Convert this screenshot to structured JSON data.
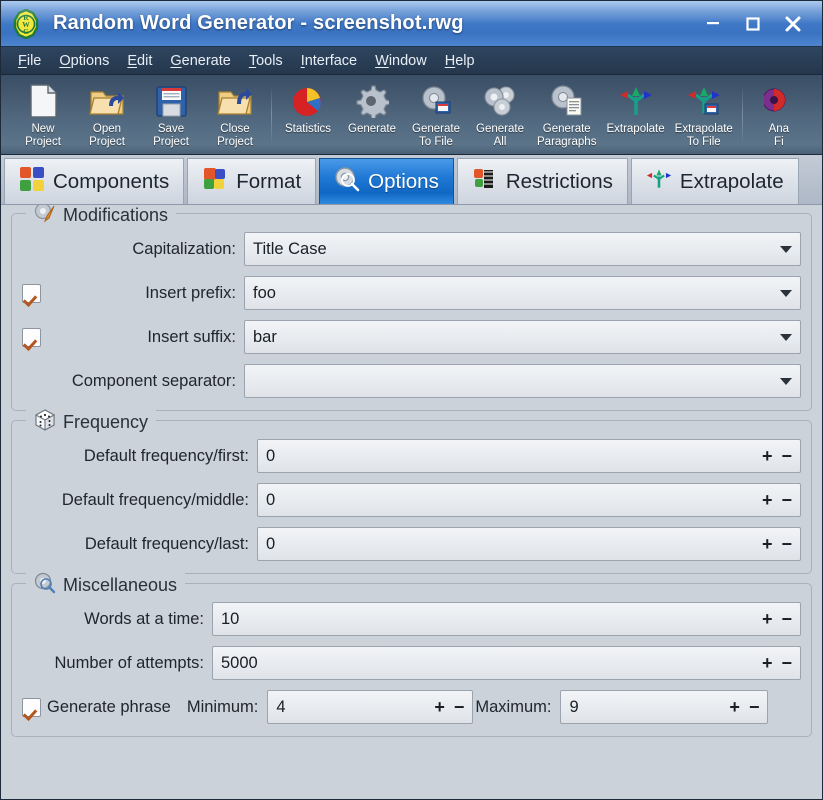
{
  "window": {
    "title": "Random Word Generator - screenshot.rwg",
    "app_icon": "rwg-logo-icon",
    "controls": {
      "minimize": "minimize-icon",
      "maximize": "maximize-icon",
      "close": "close-icon"
    }
  },
  "menubar": {
    "items": [
      {
        "label": "File",
        "mnemonic": "F"
      },
      {
        "label": "Options",
        "mnemonic": "O"
      },
      {
        "label": "Edit",
        "mnemonic": "E"
      },
      {
        "label": "Generate",
        "mnemonic": "G"
      },
      {
        "label": "Tools",
        "mnemonic": "T"
      },
      {
        "label": "Interface",
        "mnemonic": "I"
      },
      {
        "label": "Window",
        "mnemonic": "W"
      },
      {
        "label": "Help",
        "mnemonic": "H"
      }
    ]
  },
  "toolbar": {
    "items": [
      {
        "label": "New\nProject",
        "line1": "New",
        "line2": "Project",
        "icon": "new-document-icon"
      },
      {
        "label": "Open Project",
        "line1": "Open",
        "line2": "Project",
        "icon": "open-folder-icon"
      },
      {
        "label": "Save Project",
        "line1": "Save",
        "line2": "Project",
        "icon": "floppy-disk-icon"
      },
      {
        "label": "Close Project",
        "line1": "Close",
        "line2": "Project",
        "icon": "close-folder-icon"
      },
      {
        "label": "Statistics",
        "line1": "Statistics",
        "line2": "",
        "icon": "pie-chart-icon"
      },
      {
        "label": "Generate",
        "line1": "Generate",
        "line2": "",
        "icon": "gear-icon"
      },
      {
        "label": "Generate To File",
        "line1": "Generate",
        "line2": "To File",
        "icon": "gear-to-file-icon"
      },
      {
        "label": "Generate All",
        "line1": "Generate",
        "line2": "All",
        "icon": "gears-icon"
      },
      {
        "label": "Generate Paragraphs",
        "line1": "Generate",
        "line2": "Paragraphs",
        "icon": "gear-document-icon"
      },
      {
        "label": "Extrapolate",
        "line1": "Extrapolate",
        "line2": "",
        "icon": "arrows-fork-icon"
      },
      {
        "label": "Extrapolate To File",
        "line1": "Extrapolate",
        "line2": "To File",
        "icon": "arrows-fork-to-file-icon"
      },
      {
        "label": "Analyze First",
        "line1": "Ana",
        "line2": "Fi",
        "icon": "analyze-icon"
      }
    ]
  },
  "tabs": [
    {
      "label": "Components",
      "icon": "puzzle-pieces-icon",
      "active": false
    },
    {
      "label": "Format",
      "icon": "puzzle-piece-icon",
      "active": false
    },
    {
      "label": "Options",
      "icon": "gear-magnifier-icon",
      "active": true
    },
    {
      "label": "Restrictions",
      "icon": "brush-icon",
      "active": false
    },
    {
      "label": "Extrapolate",
      "icon": "arrows-fork-icon",
      "active": false
    }
  ],
  "groups": {
    "modifications": {
      "title": "Modifications",
      "icon": "gear-pencil-icon",
      "rows": [
        {
          "checkbox": null,
          "label": "Capitalization:",
          "value": "Title Case",
          "control": "combobox"
        },
        {
          "checkbox": true,
          "label": "Insert prefix:",
          "value": "foo",
          "control": "combobox"
        },
        {
          "checkbox": true,
          "label": "Insert suffix:",
          "value": "bar",
          "control": "combobox"
        },
        {
          "checkbox": null,
          "label": "Component separator:",
          "value": "",
          "control": "combobox"
        }
      ]
    },
    "frequency": {
      "title": "Frequency",
      "icon": "dice-icon",
      "rows": [
        {
          "label": "Default frequency/first:",
          "value": "0",
          "control": "spinner"
        },
        {
          "label": "Default frequency/middle:",
          "value": "0",
          "control": "spinner"
        },
        {
          "label": "Default frequency/last:",
          "value": "0",
          "control": "spinner"
        }
      ]
    },
    "miscellaneous": {
      "title": "Miscellaneous",
      "icon": "gear-magnifier-icon",
      "rows": [
        {
          "label": "Words at a time:",
          "value": "10",
          "control": "spinner"
        },
        {
          "label": "Number of attempts:",
          "value": "5000",
          "control": "spinner"
        }
      ],
      "phrase_row": {
        "checkbox": true,
        "checkbox_label": "Generate phrase",
        "minimum_label": "Minimum:",
        "minimum_value": "4",
        "maximum_label": "Maximum:",
        "maximum_value": "9"
      }
    }
  },
  "spinner": {
    "increment": "+",
    "decrement": "−"
  },
  "colors": {
    "titlebar_blue": "#3f78c6",
    "active_tab_blue": "#1168c4",
    "content_bg": "#ccd2da",
    "checkmark_orange": "#b4561f",
    "toolbar_slate": "#536b82"
  }
}
